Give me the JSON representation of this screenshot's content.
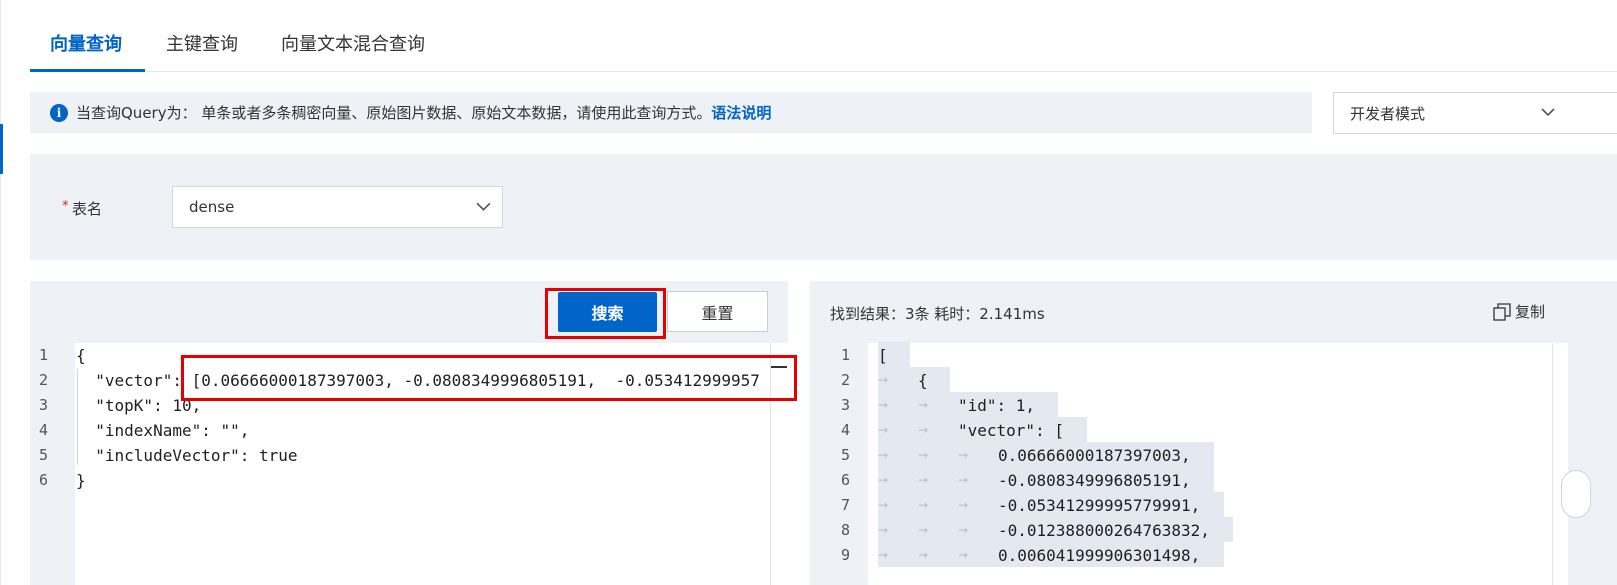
{
  "tabs": [
    {
      "label": "向量查询",
      "active": true
    },
    {
      "label": "主键查询",
      "active": false
    },
    {
      "label": "向量文本混合查询",
      "active": false
    }
  ],
  "info": {
    "icon": "info-icon",
    "text": "当查询Query为： 单条或者多条稠密向量、原始图片数据、原始文本数据，请使用此查询方式。",
    "link": "语法说明"
  },
  "mode_select": {
    "value": "开发者模式"
  },
  "form": {
    "required_mark": "*",
    "table_label": "表名",
    "table_value": "dense"
  },
  "buttons": {
    "search": "搜索",
    "reset": "重置"
  },
  "query_editor": {
    "line_numbers": [
      "1",
      "2",
      "3",
      "4",
      "5",
      "6"
    ],
    "lines": [
      "{",
      "  \"vector\": [0.06666000187397003, -0.0808349996805191,  -0.053412999957",
      "  \"topK\": 10,",
      "  \"indexName\": \"\",",
      "  \"includeVector\": true",
      "}"
    ]
  },
  "result": {
    "summary": "找到结果：3条  耗时：2.141ms",
    "copy_label": "复制",
    "line_numbers": [
      "1",
      "2",
      "3",
      "4",
      "5",
      "6",
      "7",
      "8",
      "9"
    ],
    "lines": [
      "[",
      "{",
      "\"id\": 1,",
      "\"vector\": [",
      "0.06666000187397003,",
      "-0.0808349996805191,",
      "-0.05341299995779991,",
      "-0.012388000264763832,",
      "0.006041999906301498,"
    ],
    "indent_levels": [
      0,
      1,
      2,
      2,
      3,
      3,
      3,
      3,
      3
    ]
  },
  "colors": {
    "accent": "#0064c8",
    "annotation": "#e60000",
    "panel_bg": "#eef1f6"
  }
}
